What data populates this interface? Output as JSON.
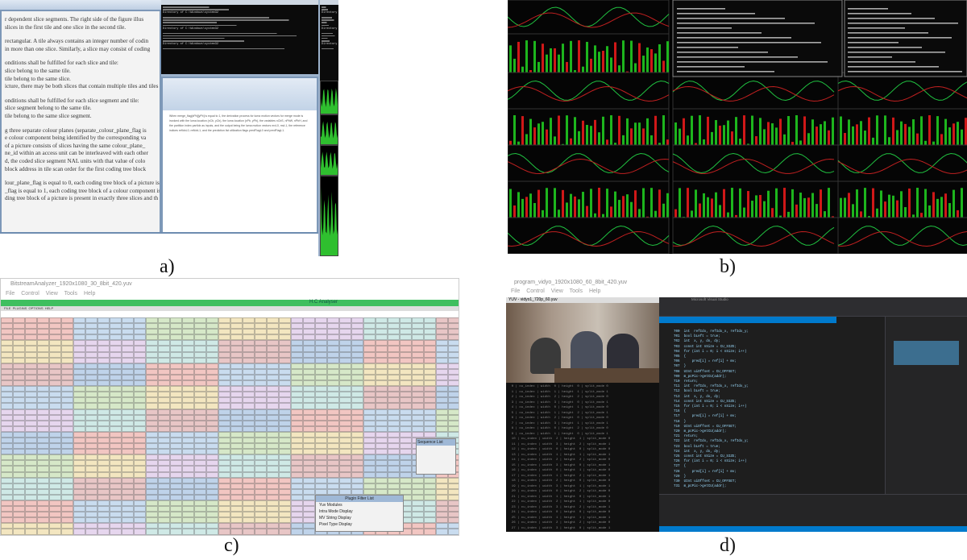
{
  "labels": {
    "a": "a)",
    "b": "b)",
    "c": "c)",
    "d": "d)"
  },
  "panel_a": {
    "doc_lines": [
      "r dependent slice segments. The right side of the figure illus",
      "slices in the first tile and one slice in the second tile.",
      "rectangular. A tile always contains an integer number of codin",
      "in more than one slice. Similarly, a slice may consist of coding",
      "onditions shall be fulfilled for each slice and tile:",
      "slice belong to the same tile.",
      "tile belong to the same slice.",
      "icture, there may be both slices that contain multiple tiles and tiles th",
      "onditions shall be fulfilled for each slice segment and tile:",
      "slice segment belong to the same tile.",
      "tile belong to the same slice segment.",
      "g three separate colour planes (separate_colour_plane_flag is",
      "e colour component being identified by the corresponding va",
      "of a picture consists of slices having the same colour_plane_",
      "ne_id within an access unit can be interleaved with each other",
      "d, the coded slice segment NAL units with that value of colo",
      "block address in tile scan order for the first coding tree block",
      "lour_plane_flag is equal to 0, each coding tree block of a picture is",
      "_flag is equal to 1, each coding tree block of a colour component is",
      "ding tree block of a picture is present in exactly three slices and th"
    ],
    "doc2_text": "When merge_flag[xPb][yPb] is equal to 1, the derivation process for luma motion vectors for merge mode is invoked with the luma location (xCb, yCb), the luma location (xPb, yPb), the variables nCbS, nPbW, nPbH, and the partition index partIdx as inputs, and the output being the luma motion vectors mvL0, mvL1, the reference indices refIdxL0, refIdxL1, and the prediction list utilization flags predFlagL0 and predFlagL1.",
    "cmd_line": "Directory of C:\\Windows\\system32"
  },
  "panel_c": {
    "title": "BitstreamAnalyzer_1920x1080_30_8bit_420.yuv",
    "menu": [
      "File",
      "Control",
      "View",
      "Tools",
      "Help"
    ],
    "app_title": "H.C Analyser",
    "submenu": [
      "FILE",
      "PLUGINS",
      "OPTIONS",
      "HELP"
    ],
    "popup_title": "Plugin Filter List",
    "popup_items": [
      "Yuv Modules",
      "Intra Mode Display",
      "MV String Display",
      "Pixel Type Display"
    ],
    "seq_title": "Sequence List"
  },
  "panel_d": {
    "title": "program_vidyo_1920x1080_60_8bit_420.yuv",
    "menu": [
      "File",
      "Control",
      "View",
      "Tools",
      "Help"
    ],
    "video_title": "YUV - vidyo1_720p_60.yuv",
    "ide_title": "Microsoft Visual Studio"
  }
}
